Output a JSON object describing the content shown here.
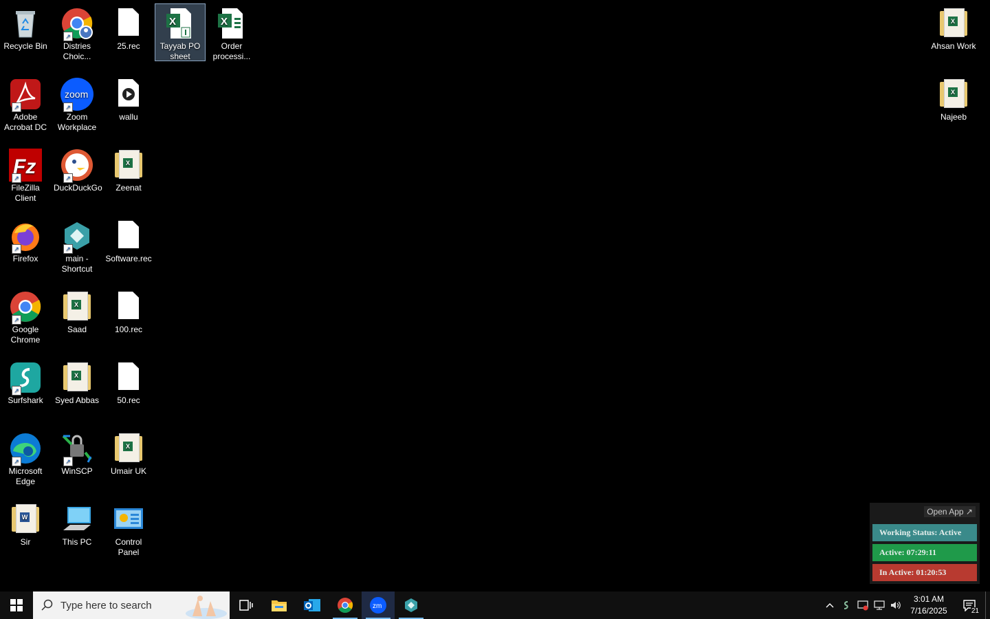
{
  "desktop": {
    "icons": [
      {
        "label": "Recycle Bin"
      },
      {
        "label": "Distries Choic..."
      },
      {
        "label": "25.rec"
      },
      {
        "label": "Tayyab PO sheet"
      },
      {
        "label": "Order processi..."
      },
      {
        "label": "Adobe Acrobat DC"
      },
      {
        "label": "Zoom Workplace"
      },
      {
        "label": "wallu"
      },
      {
        "label": "FileZilla Client"
      },
      {
        "label": "DuckDuckGo"
      },
      {
        "label": "Zeenat"
      },
      {
        "label": "Firefox"
      },
      {
        "label": "main - Shortcut"
      },
      {
        "label": "Software.rec"
      },
      {
        "label": "Google Chrome"
      },
      {
        "label": "Saad"
      },
      {
        "label": "100.rec"
      },
      {
        "label": "Surfshark"
      },
      {
        "label": "Syed Abbas"
      },
      {
        "label": "50.rec"
      },
      {
        "label": "Microsoft Edge"
      },
      {
        "label": "WinSCP"
      },
      {
        "label": "Umair UK"
      },
      {
        "label": "Sir"
      },
      {
        "label": "This PC"
      },
      {
        "label": "Control Panel"
      },
      {
        "label": "Ahsan Work"
      },
      {
        "label": "Najeeb"
      }
    ]
  },
  "widget": {
    "open_label": "Open App ↗",
    "status": "Working Status: Active",
    "active": "Active: 07:29:11",
    "inactive": "In Active: 01:20:53",
    "colors": {
      "status": "#3a8a8a",
      "active": "#1f9a4a",
      "inactive": "#b83a30"
    }
  },
  "taskbar": {
    "search_placeholder": "Type here to search",
    "time": "3:01 AM",
    "date": "7/16/2025",
    "notification_count": "21"
  }
}
